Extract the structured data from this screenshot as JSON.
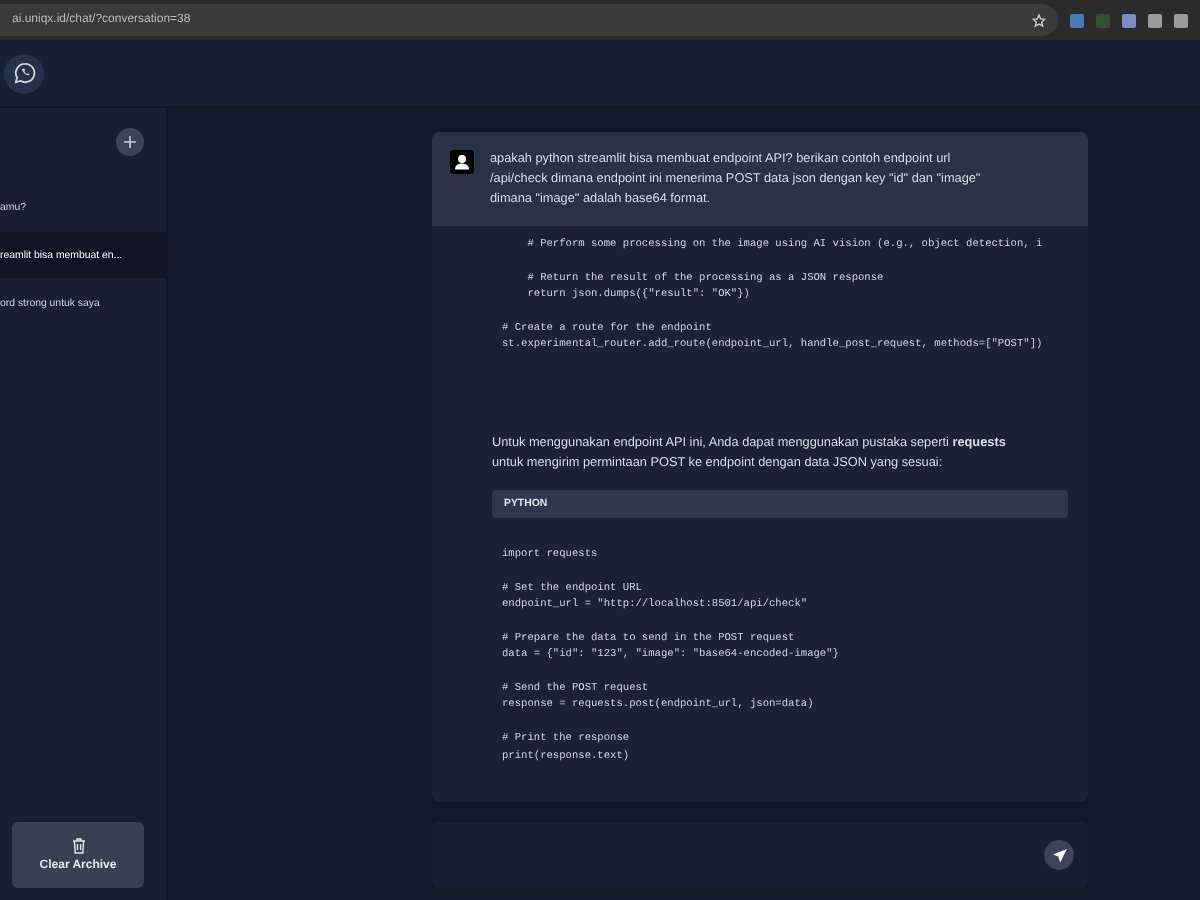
{
  "browser": {
    "url": "ai.uniqx.id/chat/?conversation=38"
  },
  "sidebar": {
    "items": [
      {
        "title": "amu?",
        "selected": false
      },
      {
        "title": "reamlit bisa membuat en...",
        "selected": true
      },
      {
        "title": "ord strong untuk saya",
        "selected": false
      }
    ],
    "clear_button": "Clear Archive"
  },
  "chat": {
    "user_message": "apakah python streamlit bisa membuat endpoint API? berikan contoh endpoint url /api/check dimana endpoint ini menerima POST data json dengan key \"id\" dan \"image\" dimana \"image\" adalah base64 format.",
    "code_top": [
      [
        "    # Perform some processing on the image using AI vision (e.g., object detection, i"
      ],
      [
        "    # Return the result of the processing as a JSON response",
        "    return json.dumps({\"result\": \"OK\"})"
      ],
      [
        "# Create a route for the endpoint",
        "st.experimental_router.add_route(endpoint_url, handle_post_request, methods=[\"POST\"])"
      ]
    ],
    "answer_text": "Untuk menggunakan endpoint API ini, Anda dapat menggunakan pustaka seperti **requests** untuk mengirim permintaan POST ke endpoint dengan data JSON yang sesuai:",
    "code_block": {
      "language": "PYTHON",
      "groups": [
        [
          "import requests"
        ],
        [
          "# Set the endpoint URL",
          "endpoint_url = \"http://localhost:8501/api/check\""
        ],
        [
          "# Prepare the data to send in the POST request",
          "data = {\"id\": \"123\", \"image\": \"base64-encoded-image\"}"
        ],
        [
          "# Send the POST request",
          "response = requests.post(endpoint_url, json=data)"
        ],
        [
          "# Print the response",
          "print(response.text)"
        ]
      ]
    }
  }
}
